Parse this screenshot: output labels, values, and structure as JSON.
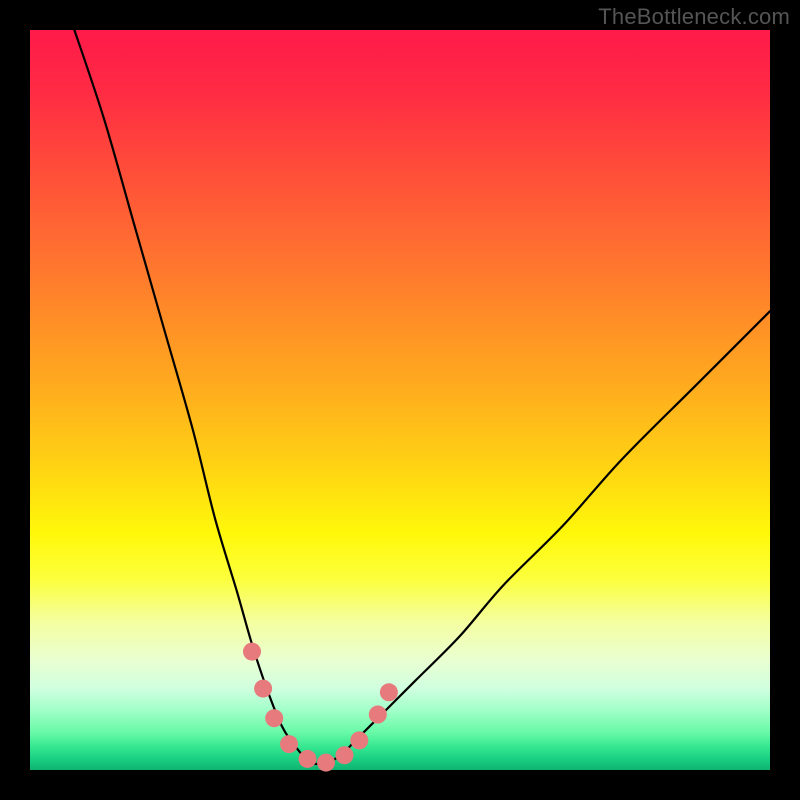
{
  "watermark": "TheBottleneck.com",
  "chart_data": {
    "type": "line",
    "title": "",
    "xlabel": "",
    "ylabel": "",
    "xlim": [
      0,
      100
    ],
    "ylim": [
      0,
      100
    ],
    "grid": false,
    "legend": false,
    "series": [
      {
        "name": "bottleneck-curve",
        "color": "#000000",
        "x": [
          6,
          10,
          14,
          18,
          22,
          25,
          28,
          30,
          32,
          34,
          36,
          38,
          40,
          42,
          44,
          47,
          52,
          58,
          64,
          72,
          80,
          90,
          100
        ],
        "y": [
          100,
          88,
          74,
          60,
          46,
          34,
          24,
          17,
          11,
          6,
          3,
          1,
          1,
          2,
          4,
          7,
          12,
          18,
          25,
          33,
          42,
          52,
          62
        ]
      }
    ],
    "markers": [
      {
        "name": "highlight-dots",
        "color": "#e77a7d",
        "radius_px": 9,
        "points": [
          {
            "x": 30.0,
            "y": 16.0
          },
          {
            "x": 31.5,
            "y": 11.0
          },
          {
            "x": 33.0,
            "y": 7.0
          },
          {
            "x": 35.0,
            "y": 3.5
          },
          {
            "x": 37.5,
            "y": 1.5
          },
          {
            "x": 40.0,
            "y": 1.0
          },
          {
            "x": 42.5,
            "y": 2.0
          },
          {
            "x": 44.5,
            "y": 4.0
          },
          {
            "x": 47.0,
            "y": 7.5
          },
          {
            "x": 48.5,
            "y": 10.5
          }
        ]
      }
    ]
  }
}
